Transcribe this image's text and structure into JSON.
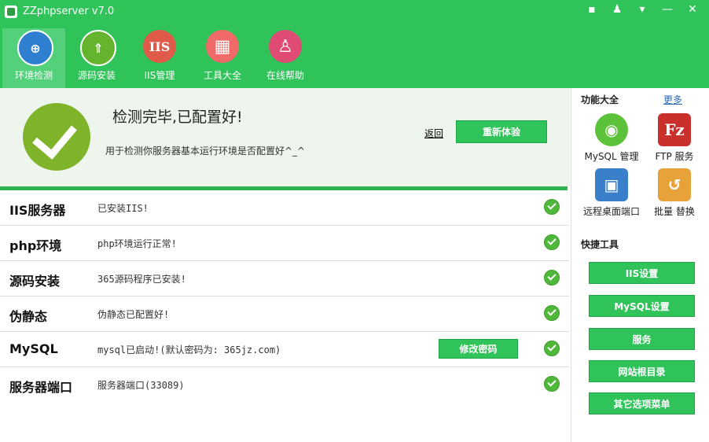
{
  "app": {
    "title": "ZZphpserver v7.0"
  },
  "window_controls": [
    {
      "name": "chat-icon",
      "glyph": "▪"
    },
    {
      "name": "skin-icon",
      "glyph": "♟"
    },
    {
      "name": "menu-icon",
      "glyph": "▾"
    },
    {
      "name": "minimize-icon",
      "glyph": "—"
    },
    {
      "name": "close-icon",
      "glyph": "✕"
    }
  ],
  "nav": [
    {
      "label": "环境检测",
      "icon": "shield-target-icon",
      "glyph": "⊕",
      "color": "#2e7fd0"
    },
    {
      "label": "源码安装",
      "icon": "install-arrows-icon",
      "glyph": "⇑",
      "color": "#66b32e"
    },
    {
      "label": "IIS管理",
      "icon": "iis-icon",
      "glyph": "IIS",
      "color": "#e05a4a"
    },
    {
      "label": "工具大全",
      "icon": "tools-grid-icon",
      "glyph": "▦",
      "color": "#f06a6a"
    },
    {
      "label": "在线帮助",
      "icon": "help-person-icon",
      "glyph": "♙",
      "color": "#e04b74"
    }
  ],
  "banner": {
    "title": "检测完毕,已配置好!",
    "subtitle": "用于检测你服务器基本运行环境是否配置好^_^",
    "back_label": "返回",
    "retest_label": "重新体验"
  },
  "rows": [
    {
      "name": "IIS服务器",
      "status": "已安装IIS!"
    },
    {
      "name": "php环境",
      "status": "php环境运行正常!"
    },
    {
      "name": "源码安装",
      "status": "365源码程序已安装!"
    },
    {
      "name": "伪静态",
      "status": "伪静态已配置好!"
    },
    {
      "name": "MySQL",
      "status": "mysql已启动!(默认密码为: 365jz.com)",
      "button": "修改密码"
    },
    {
      "name": "服务器端口",
      "status": "服务器端口(33089)"
    }
  ],
  "sidebar": {
    "features_title": "功能大全",
    "more_label": "更多",
    "features": [
      {
        "label": "MySQL 管理",
        "icon": "mysql-dolphin-icon",
        "glyph": "◉",
        "color": "#5cc23a"
      },
      {
        "label": "FTP 服务",
        "icon": "filezilla-icon",
        "glyph": "Fz",
        "color": "#c9302c"
      },
      {
        "label": "远程桌面端口",
        "icon": "remote-desktop-icon",
        "glyph": "▣",
        "color": "#3a7fc9"
      },
      {
        "label": "批量 替换",
        "icon": "folder-replace-icon",
        "glyph": "↺",
        "color": "#e8a23a"
      }
    ],
    "tools_title": "快捷工具",
    "tools": [
      "IIS设置",
      "MySQL设置",
      "服务",
      "网站根目录",
      "其它选项菜单"
    ]
  }
}
